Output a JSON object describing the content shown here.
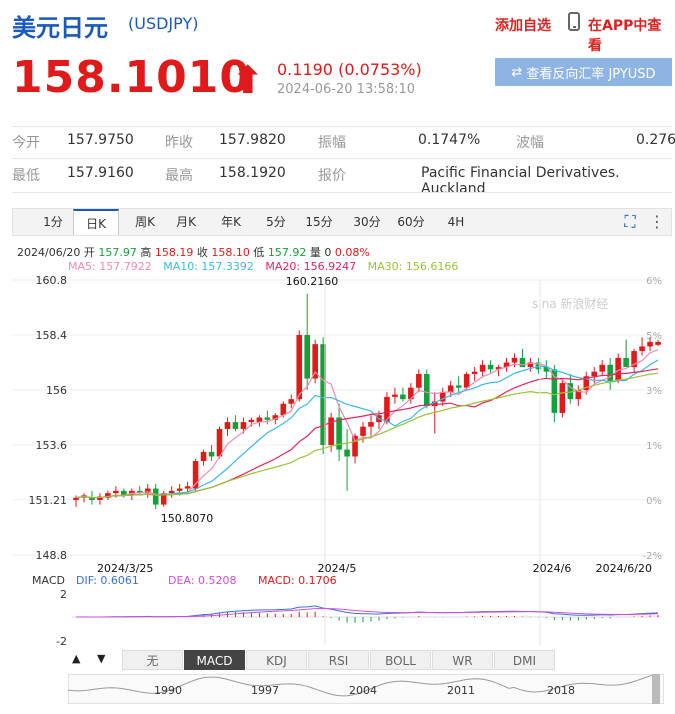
{
  "header": {
    "title": "美元日元",
    "code": "(USDJPY)",
    "add_watch": "添加自选",
    "app_view": "在APP中查看"
  },
  "quote": {
    "price": "158.1010",
    "change": "0.1190 (0.0753%)",
    "timestamp": "2024-06-20 13:58:10",
    "reverse_button": "查看反向汇率 JPYUSD"
  },
  "stats": {
    "open_label": "今开",
    "open": "157.9750",
    "prev_close_label": "昨收",
    "prev_close": "157.9820",
    "amplitude_label": "振幅",
    "amplitude": "0.1747%",
    "wave_label": "波幅",
    "wave": "0.276",
    "low_label": "最低",
    "low": "157.9160",
    "high_label": "最高",
    "high": "158.1920",
    "quote_label": "报价",
    "quote_source": "Pacific Financial Derivatives. Auckland"
  },
  "tabs": [
    "1分",
    "日K",
    "周K",
    "月K",
    "年K",
    "5分",
    "15分",
    "30分",
    "60分",
    "4H"
  ],
  "active_tab": "日K",
  "ohlc": {
    "date": "2024/06/20",
    "open_label": "开",
    "open": "157.97",
    "high_label": "高",
    "high": "158.19",
    "close_label": "收",
    "close": "158.10",
    "low_label": "低",
    "low": "157.92",
    "vol_label": "量",
    "vol": "0",
    "pct": "0.08%"
  },
  "ma": {
    "ma5": "MA5: 157.7922",
    "ma10": "MA10: 157.3392",
    "ma20": "MA20: 156.9247",
    "ma30": "MA30: 156.6166"
  },
  "colors": {
    "up": "#e01a1a",
    "down": "#15a03c",
    "ma5": "#f08ab0",
    "ma10": "#3cb8e6",
    "ma20": "#e8245a",
    "ma30": "#98c23a",
    "accent": "#1a5ab8"
  },
  "watermark": "sina 新浪财经",
  "chart_data": {
    "type": "candlestick",
    "y_ticks": [
      "160.8",
      "158.4",
      "156",
      "153.6",
      "151.21",
      "148.8"
    ],
    "pct_ticks": [
      "6%",
      "5%",
      "3%",
      "1%",
      "0%",
      "-2%"
    ],
    "x_ticks": [
      "2024/3/25",
      "2024/5",
      "2024/6",
      "2024/6/20"
    ],
    "ylim": [
      148.8,
      160.8
    ],
    "annotations": {
      "max": "160.2160",
      "min": "150.8070"
    },
    "candles": [
      [
        151.2,
        151.4,
        150.9,
        151.3
      ],
      [
        151.3,
        151.5,
        151.1,
        151.4
      ],
      [
        151.3,
        151.6,
        151.0,
        151.2
      ],
      [
        151.2,
        151.5,
        151.0,
        151.35
      ],
      [
        151.3,
        151.6,
        151.2,
        151.5
      ],
      [
        151.5,
        151.8,
        151.3,
        151.6
      ],
      [
        151.6,
        151.7,
        151.3,
        151.4
      ],
      [
        151.4,
        151.7,
        151.2,
        151.6
      ],
      [
        151.6,
        151.8,
        151.4,
        151.5
      ],
      [
        151.5,
        151.9,
        151.3,
        151.7
      ],
      [
        151.7,
        151.9,
        150.8,
        151.0
      ],
      [
        151.0,
        151.6,
        150.9,
        151.5
      ],
      [
        151.5,
        151.8,
        151.3,
        151.6
      ],
      [
        151.6,
        151.9,
        151.4,
        151.7
      ],
      [
        151.7,
        152.0,
        151.5,
        151.8
      ],
      [
        151.7,
        153.0,
        151.6,
        152.9
      ],
      [
        152.9,
        153.4,
        152.7,
        153.3
      ],
      [
        153.3,
        153.6,
        152.9,
        153.1
      ],
      [
        153.1,
        154.4,
        153.0,
        154.3
      ],
      [
        154.3,
        154.8,
        154.0,
        154.6
      ],
      [
        154.6,
        154.9,
        154.2,
        154.3
      ],
      [
        154.3,
        154.8,
        154.1,
        154.6
      ],
      [
        154.6,
        154.8,
        154.4,
        154.7
      ],
      [
        154.6,
        154.9,
        154.4,
        154.8
      ],
      [
        154.8,
        155.1,
        154.5,
        154.7
      ],
      [
        154.7,
        155.0,
        154.5,
        154.9
      ],
      [
        154.9,
        155.5,
        154.8,
        155.4
      ],
      [
        155.4,
        155.8,
        155.2,
        155.6
      ],
      [
        155.6,
        158.6,
        155.5,
        158.4
      ],
      [
        158.4,
        160.2,
        156.0,
        156.5
      ],
      [
        156.5,
        158.2,
        156.3,
        158.0
      ],
      [
        158.0,
        158.3,
        153.2,
        153.6
      ],
      [
        153.6,
        155.0,
        153.3,
        154.8
      ],
      [
        154.8,
        155.4,
        152.9,
        153.4
      ],
      [
        153.4,
        154.3,
        151.6,
        153.1
      ],
      [
        153.1,
        154.1,
        152.8,
        154.0
      ],
      [
        154.0,
        154.6,
        153.7,
        154.4
      ],
      [
        154.4,
        154.9,
        154.0,
        154.6
      ],
      [
        154.6,
        155.1,
        154.3,
        154.9
      ],
      [
        154.6,
        155.9,
        154.5,
        155.7
      ],
      [
        155.7,
        156.1,
        155.4,
        155.8
      ],
      [
        155.8,
        156.1,
        155.5,
        155.6
      ],
      [
        155.6,
        156.3,
        155.4,
        156.1
      ],
      [
        156.1,
        156.9,
        155.9,
        156.7
      ],
      [
        156.7,
        156.9,
        155.2,
        155.3
      ],
      [
        155.3,
        155.9,
        154.1,
        155.5
      ],
      [
        155.5,
        156.1,
        155.3,
        155.9
      ],
      [
        155.9,
        156.4,
        155.7,
        156.2
      ],
      [
        156.2,
        156.6,
        155.9,
        156.1
      ],
      [
        156.1,
        156.8,
        156.0,
        156.7
      ],
      [
        156.7,
        157.0,
        156.4,
        156.8
      ],
      [
        156.8,
        157.3,
        156.6,
        157.1
      ],
      [
        157.1,
        157.3,
        156.7,
        156.9
      ],
      [
        156.9,
        157.1,
        156.6,
        157.0
      ],
      [
        157.0,
        157.4,
        156.8,
        157.2
      ],
      [
        157.2,
        157.6,
        157.0,
        157.4
      ],
      [
        157.4,
        157.8,
        157.1,
        157.0
      ],
      [
        157.0,
        157.4,
        156.8,
        157.2
      ],
      [
        157.2,
        157.4,
        156.7,
        156.9
      ],
      [
        157.0,
        157.3,
        156.5,
        156.8
      ],
      [
        156.9,
        157.1,
        154.6,
        155.0
      ],
      [
        155.0,
        156.5,
        154.8,
        156.3
      ],
      [
        156.3,
        156.7,
        155.4,
        155.6
      ],
      [
        155.6,
        156.2,
        155.3,
        156.0
      ],
      [
        156.0,
        156.8,
        155.8,
        156.6
      ],
      [
        156.6,
        157.0,
        156.3,
        156.8
      ],
      [
        156.8,
        157.3,
        156.6,
        157.1
      ],
      [
        157.1,
        157.4,
        156.0,
        156.4
      ],
      [
        156.4,
        157.6,
        156.3,
        157.4
      ],
      [
        157.4,
        158.2,
        157.2,
        157.0
      ],
      [
        157.0,
        157.8,
        156.8,
        157.7
      ],
      [
        157.7,
        158.3,
        157.5,
        157.9
      ],
      [
        157.9,
        158.3,
        157.7,
        158.1
      ],
      [
        157.97,
        158.19,
        157.92,
        158.1
      ]
    ]
  },
  "macd": {
    "label": "MACD",
    "dif": "DIF: 0.6061",
    "dea": "DEA: 0.5208",
    "macd": "MACD: 0.1706",
    "y_ticks": [
      "2",
      "-2"
    ]
  },
  "indicator_tabs": [
    "无",
    "MACD",
    "KDJ",
    "RSI",
    "BOLL",
    "WR",
    "DMI"
  ],
  "active_indicator": "MACD",
  "nav": {
    "up": "▲",
    "down": "▼"
  },
  "range_years": [
    "1990",
    "1997",
    "2004",
    "2011",
    "2018"
  ]
}
